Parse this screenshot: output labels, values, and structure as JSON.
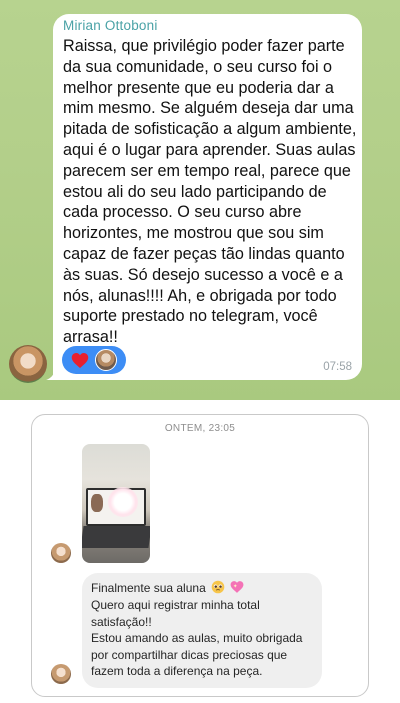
{
  "telegram": {
    "sender": "Mirian Ottoboni",
    "message": "Raissa, que privilégio poder fazer parte\nda sua comunidade, o seu curso foi o\nmelhor presente que eu poderia dar a\nmim mesmo. Se alguém deseja dar uma\npitada de sofisticação a algum ambiente,\naqui é o lugar para aprender. Suas aulas\nparecem ser em tempo real, parece que\nestou ali do seu lado participando de\ncada processo.  O seu curso abre\nhorizontes, me mostrou que sou sim\ncapaz de fazer peças tão lindas quanto\nàs suas. Só desejo sucesso a você e a\nnós, alunas!!!! Ah, e obrigada por todo\nsuporte prestado no telegram, você\narrasa!!",
    "time": "07:58",
    "reaction_icon": "heart-icon",
    "colors": {
      "sender": "#4aa2a6",
      "reaction_badge": "#3d8df5",
      "heart": "#e8202f"
    }
  },
  "direct_message": {
    "date_separator": "ONTEM, 23:05",
    "photo_description_icon": "laptop-photo",
    "first_line": "Finalmente sua aluna",
    "emojis": [
      "pleading-face-icon",
      "sparkling-heart-icon"
    ],
    "body": "Quero aqui registrar minha total\nsatisfação!!\nEstou amando as aulas, muito obrigada\npor compartilhar dicas preciosas que\nfazem toda a diferença na peça.",
    "colors": {
      "bubble": "#efefef"
    }
  }
}
